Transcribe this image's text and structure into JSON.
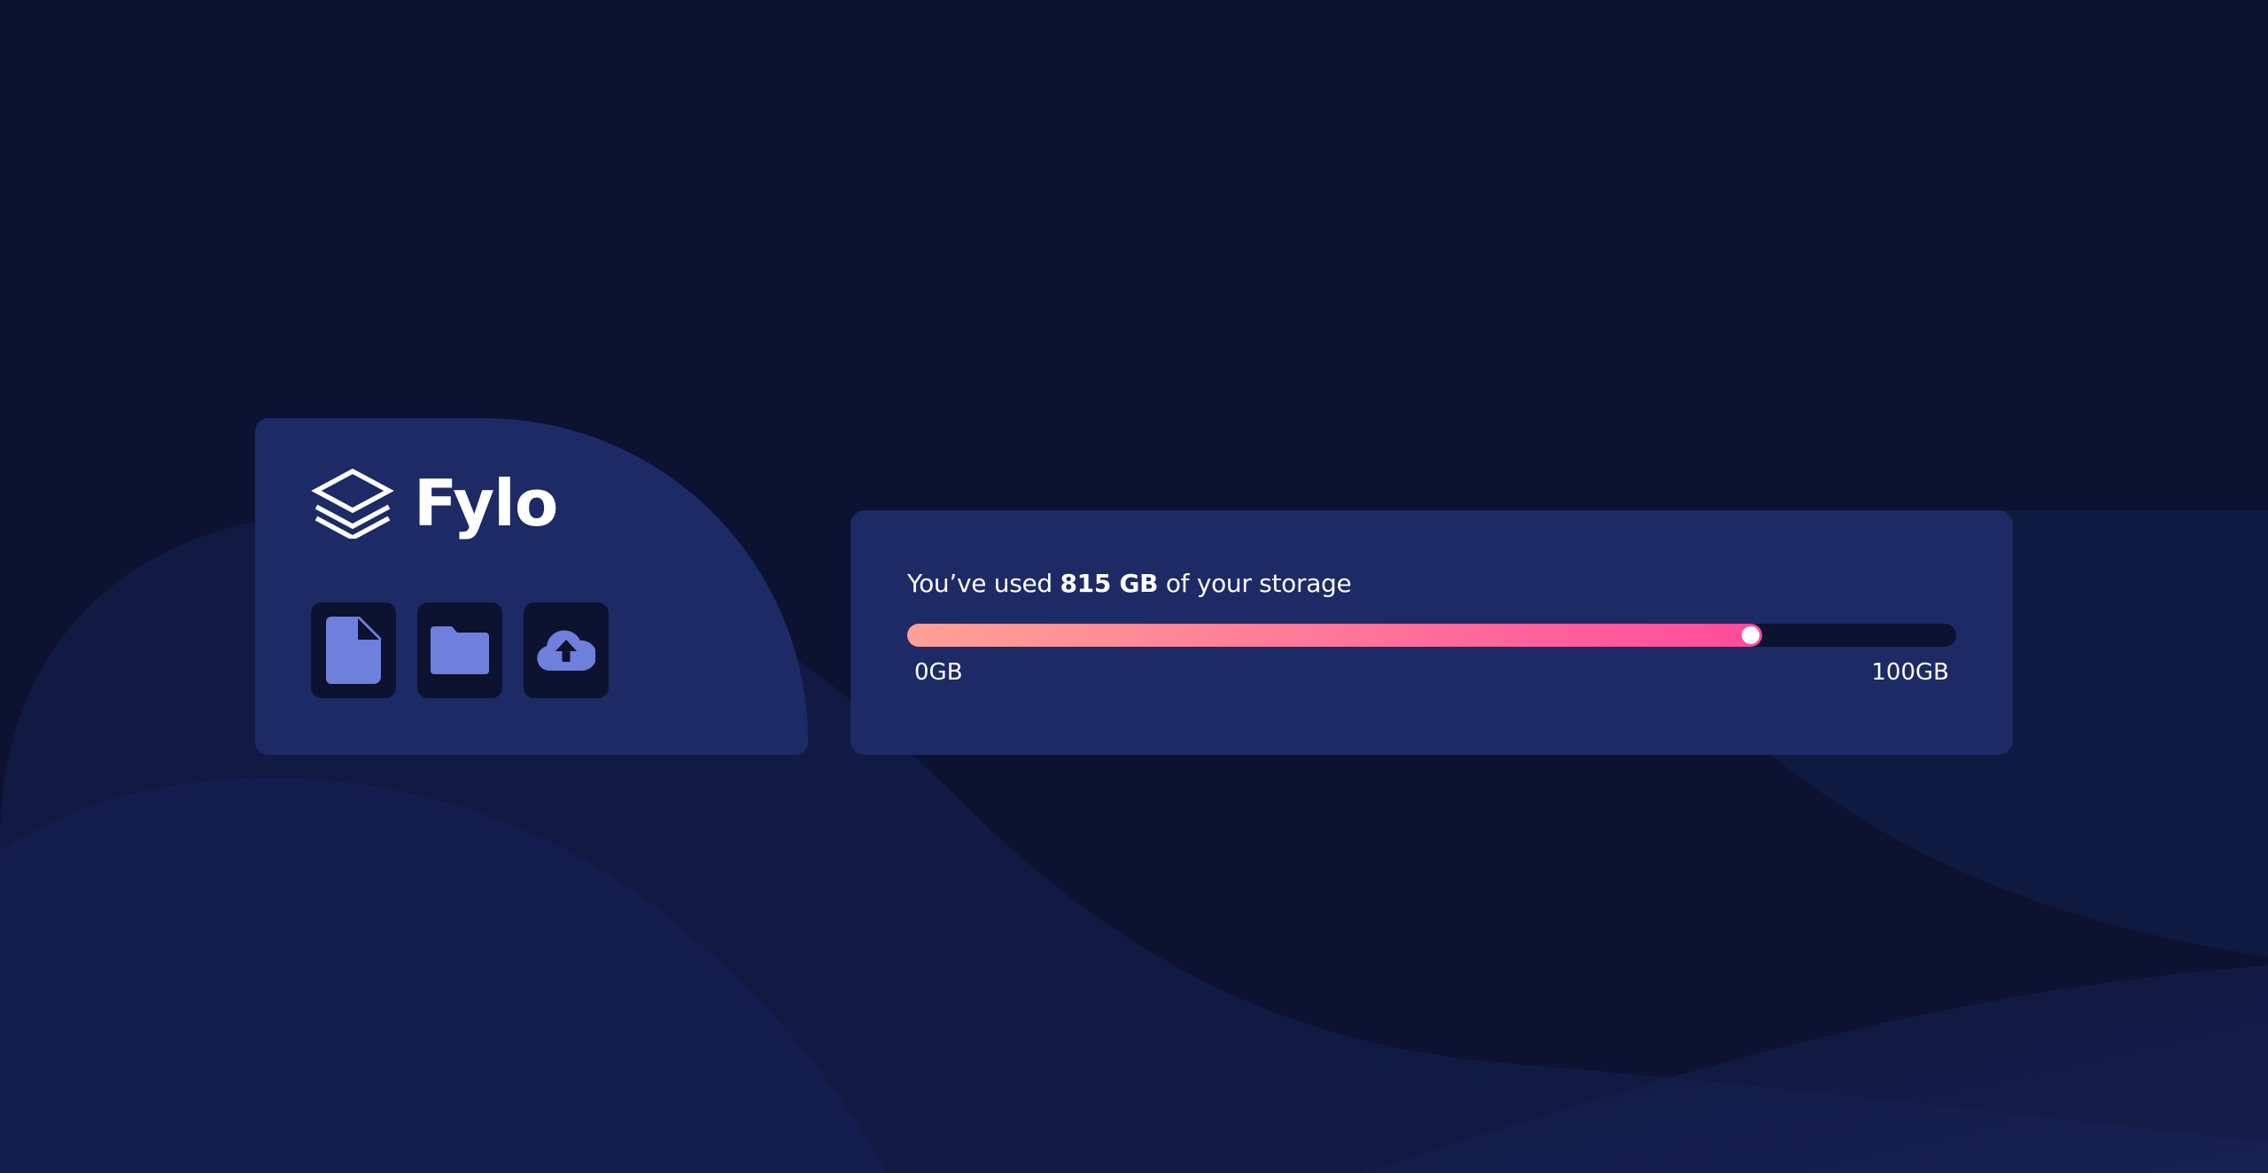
{
  "brand": {
    "name": "Fylo",
    "logo_icon": "layers-icon"
  },
  "toolbar": {
    "icons": [
      {
        "name": "document-icon",
        "color": "#6e7fdc"
      },
      {
        "name": "folder-icon",
        "color": "#6e7fdc"
      },
      {
        "name": "cloud-upload-icon",
        "color": "#6e7fdc"
      }
    ]
  },
  "storage": {
    "prefix": "You’ve used ",
    "used": "815 GB",
    "suffix": " of your storage",
    "progress_fraction": 0.815,
    "min_label": "0GB",
    "max_label": "100GB"
  },
  "colors": {
    "background": "#0c1230",
    "card": "#1e2a66",
    "accent_start": "#ffa196",
    "accent_end": "#ff4b9c",
    "icon": "#6e7fdc"
  }
}
